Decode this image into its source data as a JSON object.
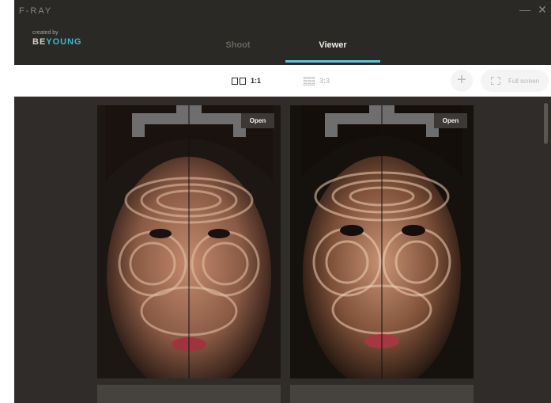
{
  "app": {
    "title": "F-RAY",
    "created_by": "created by",
    "brand_a": "BE",
    "brand_b": "YOUNG"
  },
  "window_controls": {
    "minimize": "—",
    "close": "✕"
  },
  "tabs": [
    {
      "label": "Shoot",
      "active": false
    },
    {
      "label": "Viewer",
      "active": true
    }
  ],
  "toolbar": {
    "layout_1x1": "1:1",
    "layout_3x3": "3:3",
    "add_icon": "plus-icon",
    "fullscreen_label": "Full screen"
  },
  "viewer": {
    "photos": [
      {
        "open_label": "Open",
        "subject": "face with moiré contour projection"
      },
      {
        "open_label": "Open",
        "subject": "face with moiré contour projection"
      }
    ]
  },
  "colors": {
    "accent": "#5ec3da",
    "background": "#2f2c29",
    "toolbar": "#ffffff"
  }
}
